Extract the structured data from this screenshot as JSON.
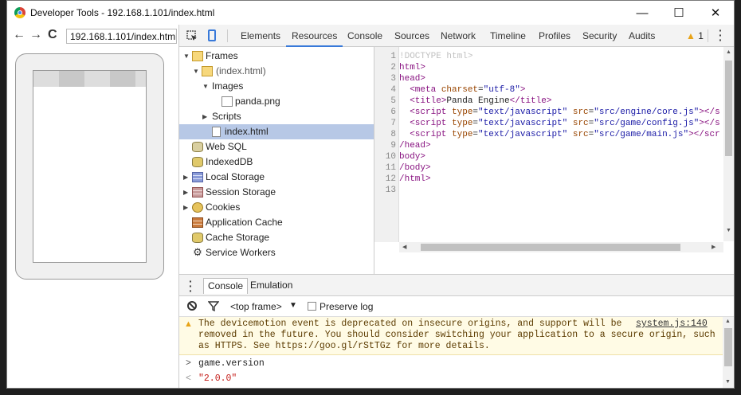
{
  "window": {
    "title": "Developer Tools - 192.168.1.101/index.html",
    "minimize": "—",
    "maximize": "☐",
    "close": "✕"
  },
  "browser": {
    "back": "←",
    "forward": "→",
    "reload": "C",
    "url": "192.168.1.101/index.html"
  },
  "tabs": [
    "Elements",
    "Resources",
    "Console",
    "Sources",
    "Network",
    "Timeline",
    "Profiles",
    "Security",
    "Audits"
  ],
  "active_tab": "Resources",
  "warning_count": "1",
  "tree": {
    "frames": "Frames",
    "index_frame": "(index.html)",
    "images": "Images",
    "panda": "panda.png",
    "scripts": "Scripts",
    "index_file": "index.html",
    "websql": "Web SQL",
    "indexeddb": "IndexedDB",
    "local": "Local Storage",
    "session": "Session Storage",
    "cookies": "Cookies",
    "appcache": "Application Cache",
    "cache": "Cache Storage",
    "sw": "Service Workers"
  },
  "source": {
    "line_numbers": [
      "1",
      "2",
      "3",
      "4",
      "5",
      "6",
      "7",
      "8",
      "9",
      "10",
      "11",
      "12",
      "13"
    ],
    "l1": "!DOCTYPE html>",
    "l2": "html>",
    "l3": "head>",
    "l4a": "  <meta ",
    "l4b": "charset",
    "l4c": "=",
    "l4d": "\"utf-8\"",
    "l4e": ">",
    "l5a": "  <title>",
    "l5b": "Panda Engine",
    "l5c": "</title>",
    "l6a": "  <script ",
    "l6b": "type",
    "l6c": "=",
    "l6d": "\"text/javascript\"",
    "l6e": " src",
    "l6f": "=",
    "l6g": "\"src/engine/core.js\"",
    "l6h": "></s",
    "l7a": "  <script ",
    "l7b": "type",
    "l7c": "=",
    "l7d": "\"text/javascript\"",
    "l7e": " src",
    "l7f": "=",
    "l7g": "\"src/game/config.js\"",
    "l7h": "></s",
    "l8a": "  <script ",
    "l8b": "type",
    "l8c": "=",
    "l8d": "\"text/javascript\"",
    "l8e": " src",
    "l8f": "=",
    "l8g": "\"src/game/main.js\"",
    "l8h": "></scr",
    "l9": "/head>",
    "l10": "body>",
    "l11": "/body>",
    "l12": "/html>"
  },
  "console": {
    "tabs": [
      "Console",
      "Emulation"
    ],
    "frame_select": "<top frame>",
    "preserve_log": "Preserve log",
    "warning_line1": "The devicemotion event is deprecated on insecure origins, and support will be",
    "warning_line2": "removed in the future. You should consider switching your application to a secure origin, such",
    "warning_line3": "as HTTPS. See https://goo.gl/rStTGz for more details.",
    "warning_source": "system.js:140",
    "input": "game.version",
    "output": "\"2.0.0\"",
    "input_prompt": ">",
    "output_prompt": "<"
  }
}
